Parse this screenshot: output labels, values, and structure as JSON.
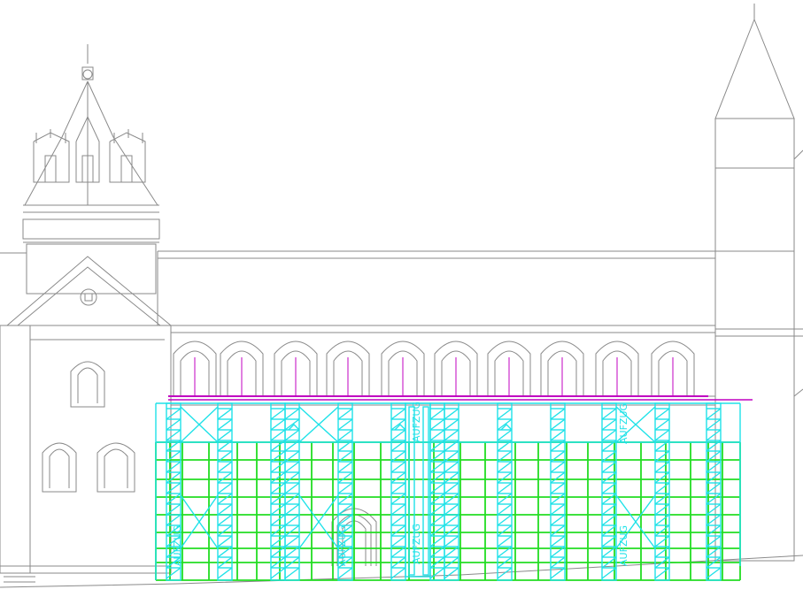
{
  "drawing": {
    "scaffold_labels": [
      "AUFZUG",
      "AUFZUG",
      "AUFZUG",
      "AUFZUG",
      "AUFZUG",
      "AUFZUG"
    ]
  },
  "colors": {
    "building_line": "#8a8a8a",
    "scaffold_frame": "#1fe2e8",
    "scaffold_tube": "#22dd22",
    "deck_rail": "#c000c0",
    "background": "#ffffff"
  }
}
